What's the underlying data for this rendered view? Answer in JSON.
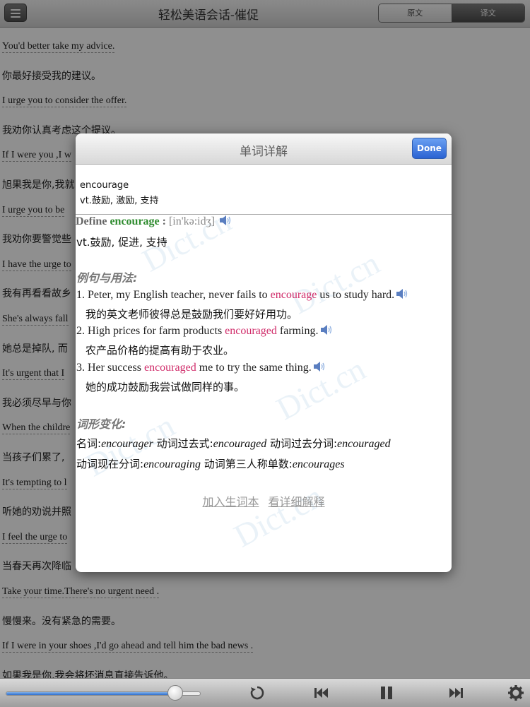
{
  "header": {
    "title": "轻松美语会话-催促",
    "tab_original": "原文",
    "tab_translation": "译文"
  },
  "background_lines": [
    {
      "text": "You'd better take my advice.",
      "lang": "en"
    },
    {
      "text": "你最好接受我的建议。",
      "lang": "zh"
    },
    {
      "text": "I urge you to consider the offer.",
      "lang": "en"
    },
    {
      "text": "我劝你认真考虑这个提议。",
      "lang": "zh"
    },
    {
      "text": "If I were you ,I w",
      "lang": "en"
    },
    {
      "text": "旭果我是你,我就",
      "lang": "zh"
    },
    {
      "text": "I urge you to be",
      "lang": "en"
    },
    {
      "text": "我劝你要警觉些",
      "lang": "zh"
    },
    {
      "text": "I have the urge to",
      "lang": "en"
    },
    {
      "text": "我有再看看故乡",
      "lang": "zh"
    },
    {
      "text": "She's always fall",
      "lang": "en"
    },
    {
      "text": "她总是掉队, 而",
      "lang": "zh"
    },
    {
      "text": "It's urgent that I",
      "lang": "en"
    },
    {
      "text": "我必须尽早与你",
      "lang": "zh"
    },
    {
      "text": "When the childre",
      "lang": "en"
    },
    {
      "text": "当孩子们累了,",
      "lang": "zh"
    },
    {
      "text": "It's tempting to l",
      "lang": "en"
    },
    {
      "text": "听她的劝说并照",
      "lang": "zh"
    },
    {
      "text": "I feel the urge to",
      "lang": "en"
    },
    {
      "text": "当春天再次降临",
      "lang": "zh"
    },
    {
      "text": "Take your time.There's no urgent need .",
      "lang": "en"
    },
    {
      "text": "慢慢来。没有紧急的需要。",
      "lang": "zh"
    },
    {
      "text": "If I were in your shoes ,I'd go ahead and tell him the bad news .",
      "lang": "en"
    },
    {
      "text": "如果我是你,我会将坏消息直接告诉他。",
      "lang": "zh"
    }
  ],
  "player": {
    "progress": 0.87
  },
  "dialog": {
    "title": "单词详解",
    "done_label": "Done",
    "word": "encourage",
    "word_sense": "vt.鼓励, 激励, 支持",
    "define_prefix": "Define",
    "define_word": "encourage",
    "define_colon": ":",
    "phonetic": "[in'kə:idʒ]",
    "define_cn": "vt.鼓励, 促进, 支持",
    "examples_heading": "例句与用法:",
    "examples": [
      {
        "num": "1.",
        "pre": "Peter, my English teacher, never fails to ",
        "hl": "encourage",
        "post": " us to study hard.",
        "cn": "我的英文老师彼得总是鼓励我们要好好用功。"
      },
      {
        "num": "2.",
        "pre": "High prices for farm products ",
        "hl": "encouraged",
        "post": " farming.",
        "cn": "农产品价格的提高有助于农业。"
      },
      {
        "num": "3.",
        "pre": "Her success ",
        "hl": "encouraged",
        "post": " me to try the same thing.",
        "cn": "她的成功鼓励我尝试做同样的事。"
      }
    ],
    "forms_heading": "词形变化:",
    "forms_line1": [
      {
        "label": "名词:",
        "value": "encourager"
      },
      {
        "label": "动词过去式:",
        "value": "encouraged"
      },
      {
        "label": "动词过去分词:",
        "value": "encouraged"
      }
    ],
    "forms_line2": [
      {
        "label": "动词现在分词:",
        "value": "encouraging"
      },
      {
        "label": "动词第三人称单数:",
        "value": "encourages"
      }
    ],
    "link_add": "加入生词本",
    "link_detail": "看详细解释",
    "watermark_text": "Dict.cn"
  }
}
